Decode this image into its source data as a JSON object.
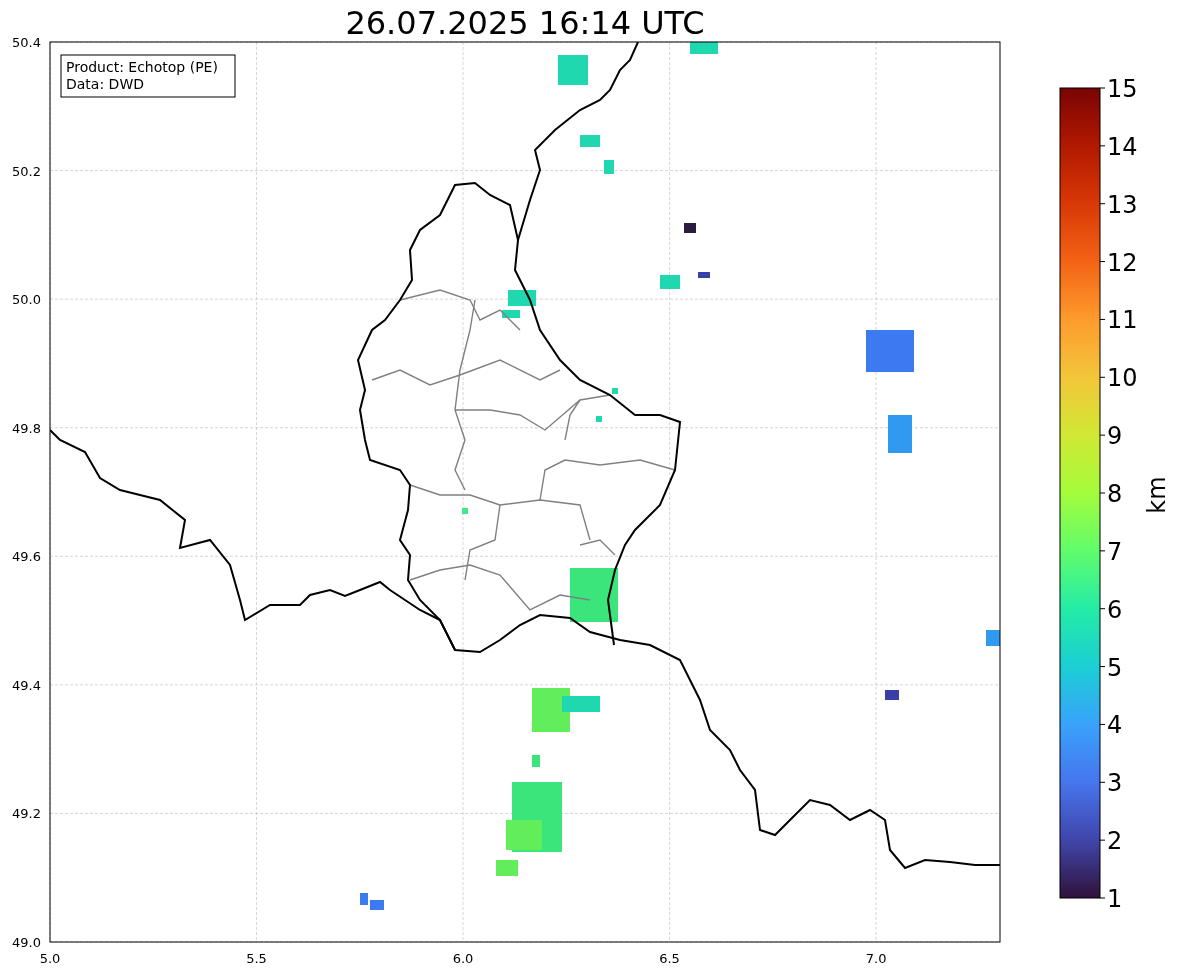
{
  "title": "26.07.2025 16:14 UTC",
  "legend": {
    "lines": [
      "Product: Echotop (PE)",
      "Data: DWD"
    ]
  },
  "map": {
    "xticks": [
      "5.0",
      "5.5",
      "6.0",
      "6.5",
      "7.0"
    ],
    "yticks": [
      "50.4",
      "50.2",
      "50.0",
      "49.8",
      "49.6",
      "49.4",
      "49.2",
      "49.0"
    ]
  },
  "colorbar": {
    "label": "km",
    "ticks": [
      "15",
      "14",
      "13",
      "12",
      "11",
      "10",
      "9",
      "8",
      "7",
      "6",
      "5",
      "4",
      "3",
      "2",
      "1"
    ]
  }
}
